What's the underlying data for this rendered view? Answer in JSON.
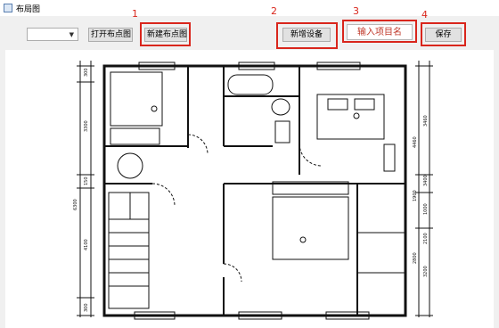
{
  "window": {
    "title": "布局图"
  },
  "toolbar": {
    "layout_select_value": "",
    "open_layout_label": "打开布点图",
    "new_layout_label": "新建布点图",
    "add_device_label": "新增设备",
    "project_name_placeholder": "输入项目名",
    "save_label": "保存"
  },
  "annotations": [
    "1",
    "2",
    "3",
    "4"
  ],
  "colors": {
    "annotation_red": "#d9261c",
    "drawing_line": "#111111"
  },
  "floorplan": {
    "dim_left": [
      "300",
      "3300",
      "150",
      "6300",
      "4100",
      "300"
    ],
    "dim_right_outer": [
      "3460",
      "3400",
      "1000",
      "2100",
      "3200"
    ],
    "dim_right_inner": [
      "4460",
      "1900",
      "2800"
    ]
  }
}
